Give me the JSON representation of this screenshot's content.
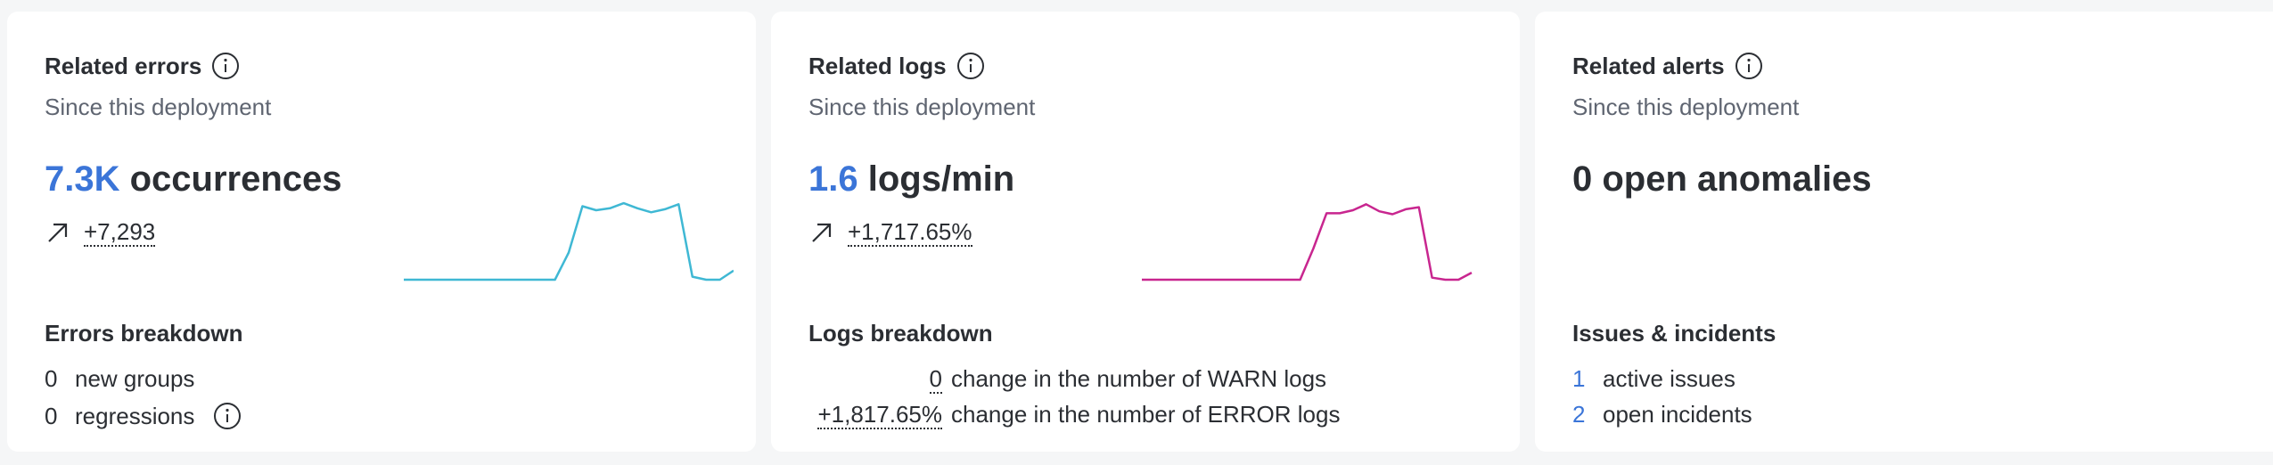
{
  "errors_card": {
    "title": "Related errors",
    "subtitle": "Since this deployment",
    "big_value": "7.3K",
    "big_unit": "occurrences",
    "trend": "+7,293",
    "breakdown_title": "Errors breakdown",
    "items": [
      {
        "count": "0",
        "label": "new groups"
      },
      {
        "count": "0",
        "label": "regressions"
      }
    ],
    "color": "#3fb8d4"
  },
  "logs_card": {
    "title": "Related logs",
    "subtitle": "Since this deployment",
    "big_value": "1.6",
    "big_unit": "logs/min",
    "trend": "+1,717.65%",
    "breakdown_title": "Logs breakdown",
    "items": [
      {
        "count": "0",
        "label": "change in the number of WARN logs"
      },
      {
        "count": "+1,817.65%",
        "label": "change in the number of ERROR logs"
      }
    ],
    "color": "#c8268f"
  },
  "alerts_card": {
    "title": "Related alerts",
    "subtitle": "Since this deployment",
    "big_text": "0 open anomalies",
    "breakdown_title": "Issues & incidents",
    "items": [
      {
        "count": "1",
        "label": "active issues"
      },
      {
        "count": "2",
        "label": "open incidents"
      }
    ]
  },
  "chart_data": [
    {
      "type": "line",
      "series": [
        {
          "values": [
            0,
            0,
            0,
            0,
            0,
            0,
            0,
            0,
            0,
            0,
            0,
            0,
            0.27,
            0.73,
            0.69,
            0.71,
            0.76,
            0.71,
            0.67,
            0.7,
            0.75,
            0.03,
            0,
            0,
            0.09
          ]
        }
      ]
    },
    {
      "type": "line",
      "series": [
        {
          "values": [
            0,
            0,
            0,
            0,
            0,
            0,
            0,
            0,
            0,
            0,
            0,
            0,
            0,
            0.31,
            0.66,
            0.66,
            0.69,
            0.75,
            0.68,
            0.65,
            0.7,
            0.72,
            0.02,
            0,
            0,
            0.07
          ]
        }
      ]
    }
  ],
  "icons": {
    "info": "info-icon",
    "trend": "arrow-up-right-icon"
  }
}
